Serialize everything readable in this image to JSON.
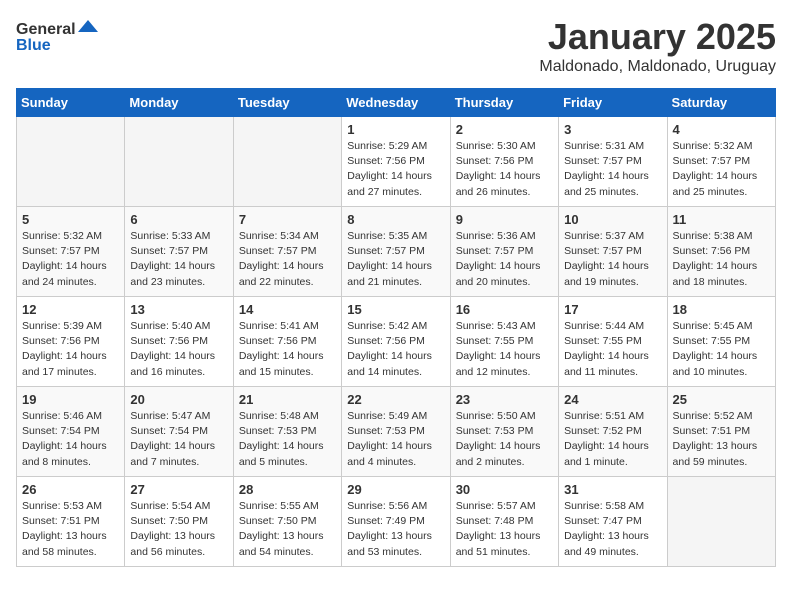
{
  "header": {
    "logo_general": "General",
    "logo_blue": "Blue",
    "month": "January 2025",
    "location": "Maldonado, Maldonado, Uruguay"
  },
  "weekdays": [
    "Sunday",
    "Monday",
    "Tuesday",
    "Wednesday",
    "Thursday",
    "Friday",
    "Saturday"
  ],
  "weeks": [
    [
      {
        "day": "",
        "info": ""
      },
      {
        "day": "",
        "info": ""
      },
      {
        "day": "",
        "info": ""
      },
      {
        "day": "1",
        "info": "Sunrise: 5:29 AM\nSunset: 7:56 PM\nDaylight: 14 hours\nand 27 minutes."
      },
      {
        "day": "2",
        "info": "Sunrise: 5:30 AM\nSunset: 7:56 PM\nDaylight: 14 hours\nand 26 minutes."
      },
      {
        "day": "3",
        "info": "Sunrise: 5:31 AM\nSunset: 7:57 PM\nDaylight: 14 hours\nand 25 minutes."
      },
      {
        "day": "4",
        "info": "Sunrise: 5:32 AM\nSunset: 7:57 PM\nDaylight: 14 hours\nand 25 minutes."
      }
    ],
    [
      {
        "day": "5",
        "info": "Sunrise: 5:32 AM\nSunset: 7:57 PM\nDaylight: 14 hours\nand 24 minutes."
      },
      {
        "day": "6",
        "info": "Sunrise: 5:33 AM\nSunset: 7:57 PM\nDaylight: 14 hours\nand 23 minutes."
      },
      {
        "day": "7",
        "info": "Sunrise: 5:34 AM\nSunset: 7:57 PM\nDaylight: 14 hours\nand 22 minutes."
      },
      {
        "day": "8",
        "info": "Sunrise: 5:35 AM\nSunset: 7:57 PM\nDaylight: 14 hours\nand 21 minutes."
      },
      {
        "day": "9",
        "info": "Sunrise: 5:36 AM\nSunset: 7:57 PM\nDaylight: 14 hours\nand 20 minutes."
      },
      {
        "day": "10",
        "info": "Sunrise: 5:37 AM\nSunset: 7:57 PM\nDaylight: 14 hours\nand 19 minutes."
      },
      {
        "day": "11",
        "info": "Sunrise: 5:38 AM\nSunset: 7:56 PM\nDaylight: 14 hours\nand 18 minutes."
      }
    ],
    [
      {
        "day": "12",
        "info": "Sunrise: 5:39 AM\nSunset: 7:56 PM\nDaylight: 14 hours\nand 17 minutes."
      },
      {
        "day": "13",
        "info": "Sunrise: 5:40 AM\nSunset: 7:56 PM\nDaylight: 14 hours\nand 16 minutes."
      },
      {
        "day": "14",
        "info": "Sunrise: 5:41 AM\nSunset: 7:56 PM\nDaylight: 14 hours\nand 15 minutes."
      },
      {
        "day": "15",
        "info": "Sunrise: 5:42 AM\nSunset: 7:56 PM\nDaylight: 14 hours\nand 14 minutes."
      },
      {
        "day": "16",
        "info": "Sunrise: 5:43 AM\nSunset: 7:55 PM\nDaylight: 14 hours\nand 12 minutes."
      },
      {
        "day": "17",
        "info": "Sunrise: 5:44 AM\nSunset: 7:55 PM\nDaylight: 14 hours\nand 11 minutes."
      },
      {
        "day": "18",
        "info": "Sunrise: 5:45 AM\nSunset: 7:55 PM\nDaylight: 14 hours\nand 10 minutes."
      }
    ],
    [
      {
        "day": "19",
        "info": "Sunrise: 5:46 AM\nSunset: 7:54 PM\nDaylight: 14 hours\nand 8 minutes."
      },
      {
        "day": "20",
        "info": "Sunrise: 5:47 AM\nSunset: 7:54 PM\nDaylight: 14 hours\nand 7 minutes."
      },
      {
        "day": "21",
        "info": "Sunrise: 5:48 AM\nSunset: 7:53 PM\nDaylight: 14 hours\nand 5 minutes."
      },
      {
        "day": "22",
        "info": "Sunrise: 5:49 AM\nSunset: 7:53 PM\nDaylight: 14 hours\nand 4 minutes."
      },
      {
        "day": "23",
        "info": "Sunrise: 5:50 AM\nSunset: 7:53 PM\nDaylight: 14 hours\nand 2 minutes."
      },
      {
        "day": "24",
        "info": "Sunrise: 5:51 AM\nSunset: 7:52 PM\nDaylight: 14 hours\nand 1 minute."
      },
      {
        "day": "25",
        "info": "Sunrise: 5:52 AM\nSunset: 7:51 PM\nDaylight: 13 hours\nand 59 minutes."
      }
    ],
    [
      {
        "day": "26",
        "info": "Sunrise: 5:53 AM\nSunset: 7:51 PM\nDaylight: 13 hours\nand 58 minutes."
      },
      {
        "day": "27",
        "info": "Sunrise: 5:54 AM\nSunset: 7:50 PM\nDaylight: 13 hours\nand 56 minutes."
      },
      {
        "day": "28",
        "info": "Sunrise: 5:55 AM\nSunset: 7:50 PM\nDaylight: 13 hours\nand 54 minutes."
      },
      {
        "day": "29",
        "info": "Sunrise: 5:56 AM\nSunset: 7:49 PM\nDaylight: 13 hours\nand 53 minutes."
      },
      {
        "day": "30",
        "info": "Sunrise: 5:57 AM\nSunset: 7:48 PM\nDaylight: 13 hours\nand 51 minutes."
      },
      {
        "day": "31",
        "info": "Sunrise: 5:58 AM\nSunset: 7:47 PM\nDaylight: 13 hours\nand 49 minutes."
      },
      {
        "day": "",
        "info": ""
      }
    ]
  ]
}
